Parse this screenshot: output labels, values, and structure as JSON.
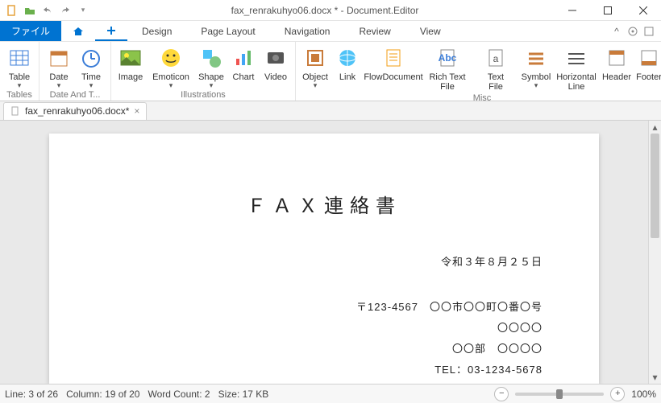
{
  "title": "fax_renrakuhyo06.docx * - Document.Editor",
  "menubar": {
    "file": "ファイル",
    "tabs": [
      "Design",
      "Page Layout",
      "Navigation",
      "Review",
      "View"
    ]
  },
  "ribbon": {
    "groups": [
      {
        "label": "Tables",
        "btns": [
          {
            "label": "Table",
            "drop": true
          }
        ]
      },
      {
        "label": "Date And T...",
        "btns": [
          {
            "label": "Date",
            "drop": true
          },
          {
            "label": "Time",
            "drop": true
          }
        ]
      },
      {
        "label": "Illustrations",
        "btns": [
          {
            "label": "Image"
          },
          {
            "label": "Emoticon",
            "drop": true
          },
          {
            "label": "Shape",
            "drop": true
          },
          {
            "label": "Chart"
          },
          {
            "label": "Video"
          }
        ]
      },
      {
        "label": "Misc",
        "btns": [
          {
            "label": "Object",
            "drop": true
          },
          {
            "label": "Link"
          },
          {
            "label": "FlowDocument"
          },
          {
            "label": "Rich Text\nFile"
          },
          {
            "label": "Text\nFile"
          },
          {
            "label": "Symbol",
            "drop": true
          },
          {
            "label": "Horizontal\nLine"
          },
          {
            "label": "Header"
          },
          {
            "label": "Footer"
          }
        ]
      }
    ]
  },
  "tabname": "fax_renrakuhyo06.docx*",
  "document": {
    "heading": "ＦＡＸ連絡書",
    "date": "令和３年８月２５日",
    "lines": [
      "〒123-4567　〇〇市〇〇町〇番〇号",
      "〇〇〇〇",
      "〇〇部　〇〇〇〇",
      "TEL：03-1234-5678"
    ]
  },
  "status": {
    "line": "Line: 3 of 26",
    "col": "Column: 19 of 20",
    "words": "Word Count: 2",
    "size": "Size: 17 KB",
    "zoom": "100%"
  }
}
